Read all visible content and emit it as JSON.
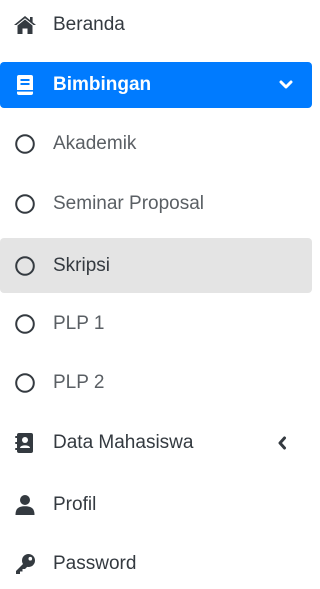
{
  "nav": {
    "beranda": "Beranda",
    "bimbingan": "Bimbingan",
    "sub": {
      "akademik": "Akademik",
      "seminar": "Seminar Proposal",
      "skripsi": "Skripsi",
      "plp1": "PLP 1",
      "plp2": "PLP 2"
    },
    "data_mahasiswa": "Data Mahasiswa",
    "profil": "Profil",
    "password": "Password"
  },
  "colors": {
    "accent": "#007bff",
    "hover": "#e4e4e4",
    "text": "#343a40"
  },
  "icons": {
    "beranda": "home-icon",
    "bimbingan": "book-icon",
    "submenu": "circle-outline-icon",
    "data_mahasiswa": "address-book-icon",
    "profil": "user-icon",
    "password": "key-icon",
    "expanded": "chevron-down-icon",
    "collapsed": "chevron-left-icon"
  }
}
